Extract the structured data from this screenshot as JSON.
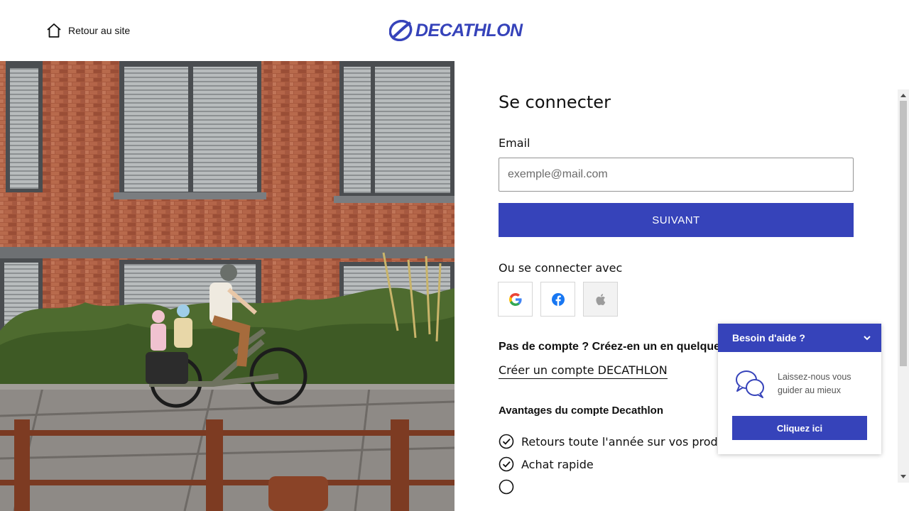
{
  "header": {
    "back_label": "Retour au site",
    "logo_text": "DECATHLON"
  },
  "login": {
    "title": "Se connecter",
    "email_label": "Email",
    "email_placeholder": "exemple@mail.com",
    "email_value": "",
    "next_button": "SUIVANT",
    "or_label": "Ou se connecter avec",
    "social": [
      "google-icon",
      "facebook-icon",
      "apple-icon"
    ],
    "no_account": "Pas de compte ? Créez-en un en quelque",
    "create_link": "Créer un compte DECATHLON",
    "benefits_title": "Avantages du compte Decathlon",
    "benefits": [
      "Retours toute l'année sur vos produits",
      "Achat rapide"
    ]
  },
  "help": {
    "title": "Besoin d'aide ?",
    "message": "Laissez-nous vous guider au mieux",
    "button": "Cliquez ici"
  },
  "colors": {
    "brand": "#3643ba",
    "text": "#101010"
  }
}
